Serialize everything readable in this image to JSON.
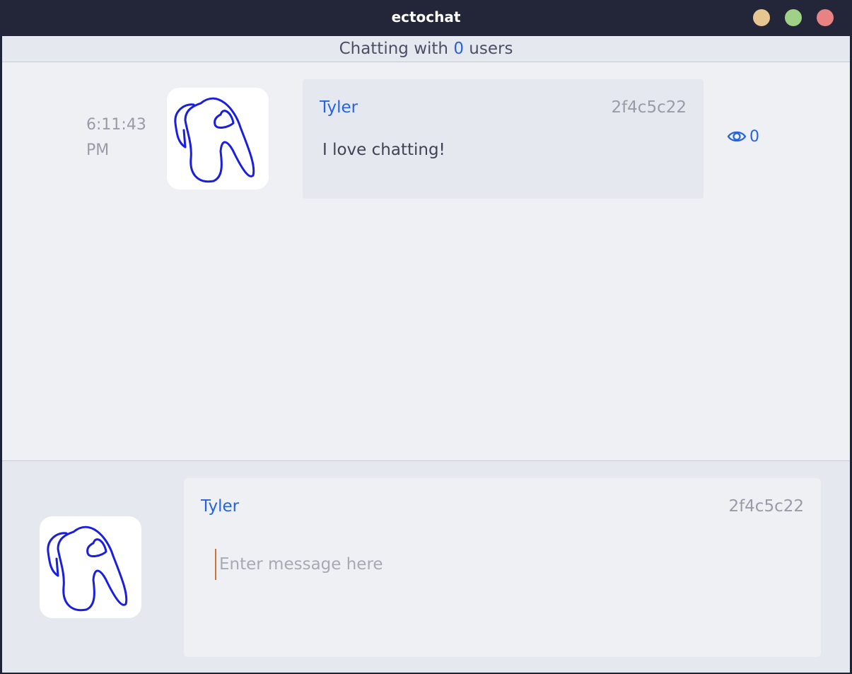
{
  "window": {
    "title": "ectochat",
    "controls": {
      "minimize_color": "#e6c590",
      "maximize_color": "#9fd286",
      "close_color": "#e98383"
    }
  },
  "status": {
    "prefix": "Chatting with",
    "count": "0",
    "suffix": "users"
  },
  "messages": [
    {
      "time_line1": "6:11:43",
      "time_line2": "PM",
      "author": "Tyler",
      "id": "2f4c5c22",
      "text": "I love chatting!",
      "seen_count": "0",
      "avatar_icon": "hand-drawn-crewmate-avatar"
    }
  ],
  "composer": {
    "author": "Tyler",
    "id": "2f4c5c22",
    "placeholder": "Enter message here",
    "value": "",
    "avatar_icon": "hand-drawn-crewmate-avatar"
  },
  "colors": {
    "accent": "#2563e0",
    "muted": "#9a9ba8",
    "text": "#3f4354",
    "drawing": "#1a1ee0"
  }
}
